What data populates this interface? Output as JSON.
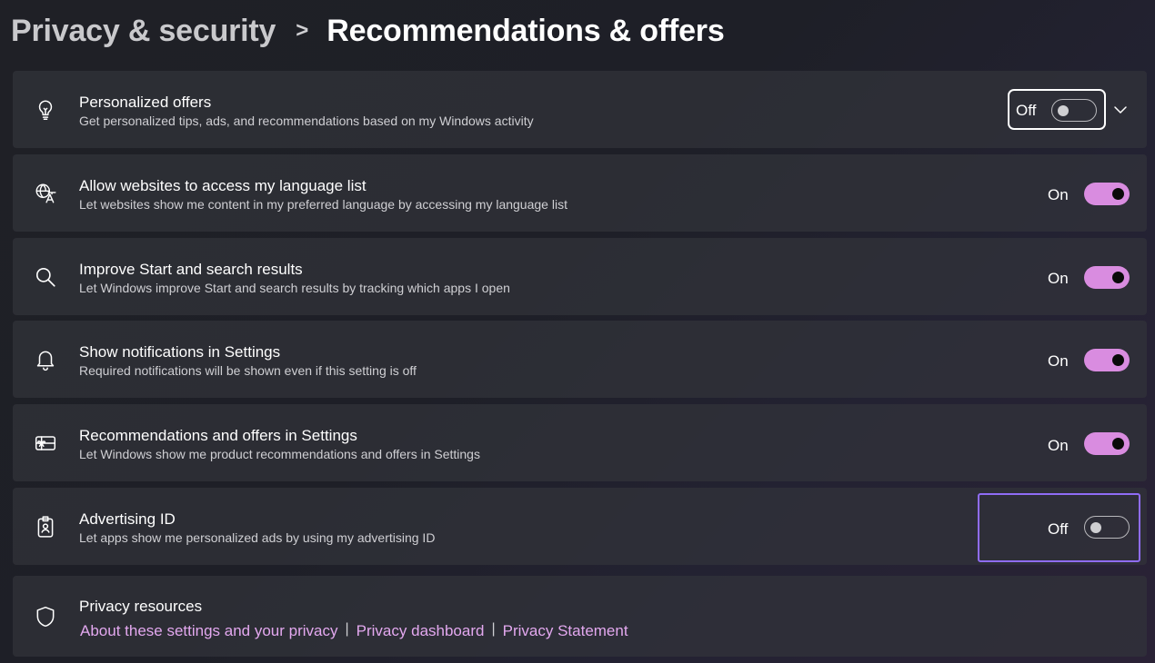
{
  "breadcrumb": {
    "parent": "Privacy & security",
    "separator": ">",
    "current": "Recommendations & offers"
  },
  "settings": [
    {
      "icon": "lightbulb-icon",
      "title": "Personalized offers",
      "description": "Get personalized tips, ads, and recommendations based on my Windows activity",
      "state_label": "Off",
      "state": false,
      "expandable": true
    },
    {
      "icon": "language-icon",
      "title": "Allow websites to access my language list",
      "description": "Let websites show me content in my preferred language by accessing my language list",
      "state_label": "On",
      "state": true
    },
    {
      "icon": "search-icon",
      "title": "Improve Start and search results",
      "description": "Let Windows improve Start and search results by tracking which apps I open",
      "state_label": "On",
      "state": true
    },
    {
      "icon": "bell-icon",
      "title": "Show notifications in Settings",
      "description": "Required notifications will be shown even if this setting is off",
      "state_label": "On",
      "state": true
    },
    {
      "icon": "gift-card-icon",
      "title": "Recommendations and offers in Settings",
      "description": "Let Windows show me product recommendations and offers in Settings",
      "state_label": "On",
      "state": true
    },
    {
      "icon": "id-badge-icon",
      "title": "Advertising ID",
      "description": "Let apps show me personalized ads by using my advertising ID",
      "state_label": "Off",
      "state": false
    }
  ],
  "privacy_resources": {
    "icon": "shield-icon",
    "title": "Privacy resources",
    "links": [
      "About these settings and your privacy",
      "Privacy dashboard",
      "Privacy Statement"
    ],
    "link_separator": "|"
  },
  "colors": {
    "toggle_on": "#d98ce0",
    "link": "#e3a8ef",
    "highlight": "#8f6cf5"
  }
}
